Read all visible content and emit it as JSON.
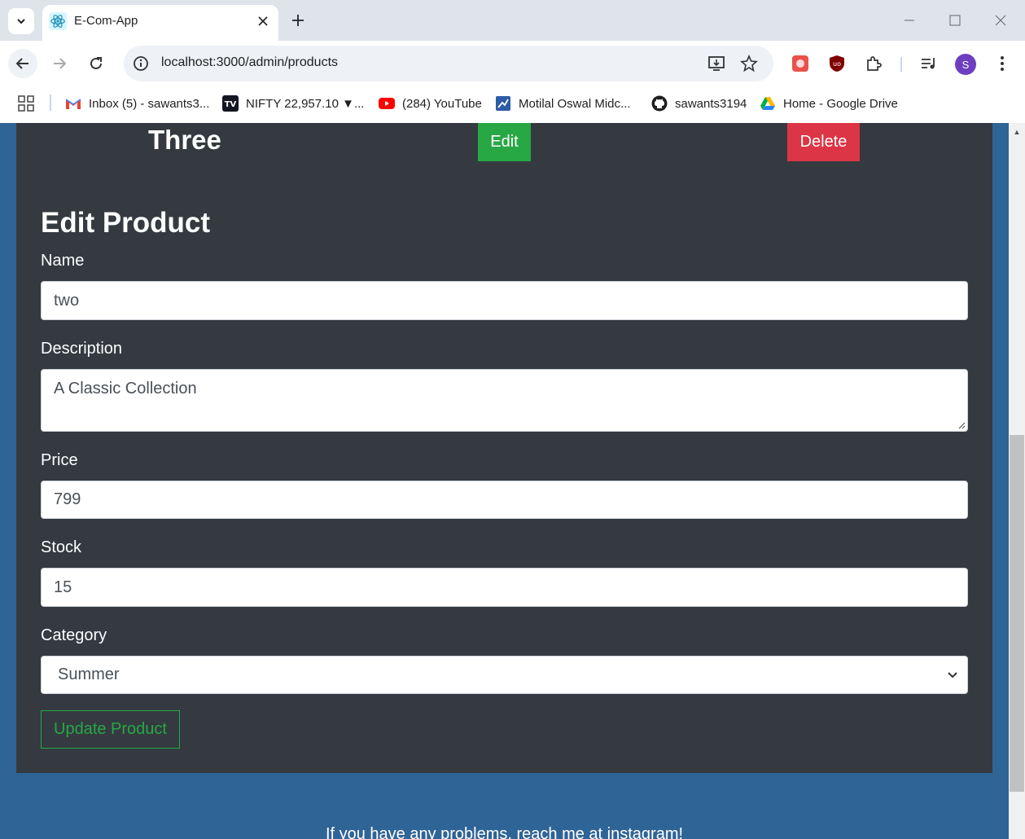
{
  "browser": {
    "tab_title": "E-Com-App",
    "url": "localhost:3000/admin/products",
    "profile_initial": "S"
  },
  "bookmarks": [
    {
      "label": "Inbox (5) - sawants3...",
      "icon": "gmail-icon"
    },
    {
      "label": "NIFTY 22,957.10 ▼...",
      "icon": "tradingview-icon"
    },
    {
      "label": "(284) YouTube",
      "icon": "youtube-icon"
    },
    {
      "label": "Motilal Oswal Midc...",
      "icon": "motilal-icon"
    },
    {
      "label": "sawants3194",
      "icon": "github-icon"
    },
    {
      "label": "Home - Google Drive",
      "icon": "google-drive-icon"
    }
  ],
  "product_row": {
    "name": "Three",
    "edit_label": "Edit",
    "delete_label": "Delete"
  },
  "form": {
    "title": "Edit Product",
    "name_label": "Name",
    "name_value": "two",
    "description_label": "Description",
    "description_value": "A Classic Collection",
    "price_label": "Price",
    "price_value": "799",
    "stock_label": "Stock",
    "stock_value": "15",
    "category_label": "Category",
    "category_value": "Summer",
    "submit_label": "Update Product"
  },
  "footer": {
    "text": "If you have any problems, reach me at instagram!"
  },
  "colors": {
    "page_bg": "#2f6496",
    "panel_bg": "#343a40",
    "success": "#28a745",
    "danger": "#dc3545"
  }
}
